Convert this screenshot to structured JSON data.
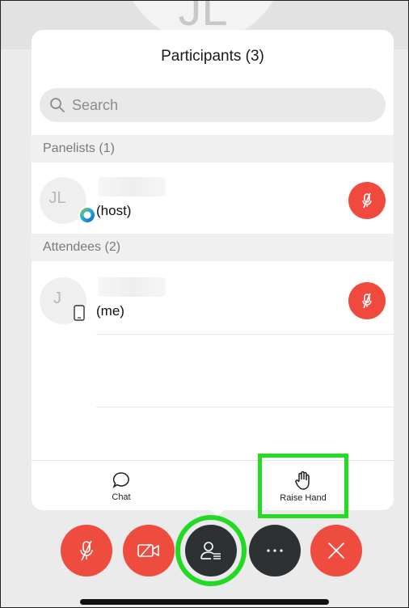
{
  "background": {
    "ghost_initials": "JL"
  },
  "panel": {
    "title": "Participants (3)",
    "search_placeholder": "Search",
    "sections": [
      {
        "header": "Panelists (1)",
        "participants": [
          {
            "initials": "JL",
            "role": "(host)",
            "badge": "host-webex-icon",
            "mic": "muted"
          }
        ]
      },
      {
        "header": "Attendees (2)",
        "participants": [
          {
            "initials": "J",
            "role": "(me)",
            "badge": "phone-icon",
            "mic": "muted"
          }
        ]
      }
    ],
    "footer": {
      "chat_label": "Chat",
      "raise_hand_label": "Raise Hand"
    }
  },
  "controls": [
    {
      "name": "mute",
      "icon": "microphone-muted-icon",
      "color": "#ee4c3f"
    },
    {
      "name": "video",
      "icon": "video-off-icon",
      "color": "#ee4c3f"
    },
    {
      "name": "participants",
      "icon": "participants-icon",
      "color": "#2e3134"
    },
    {
      "name": "more",
      "icon": "more-icon",
      "color": "#2e3134"
    },
    {
      "name": "leave",
      "icon": "close-icon",
      "color": "#ee4c3f"
    }
  ],
  "colors": {
    "accent_red": "#ef4a3d",
    "highlight_green": "#22dd22"
  }
}
